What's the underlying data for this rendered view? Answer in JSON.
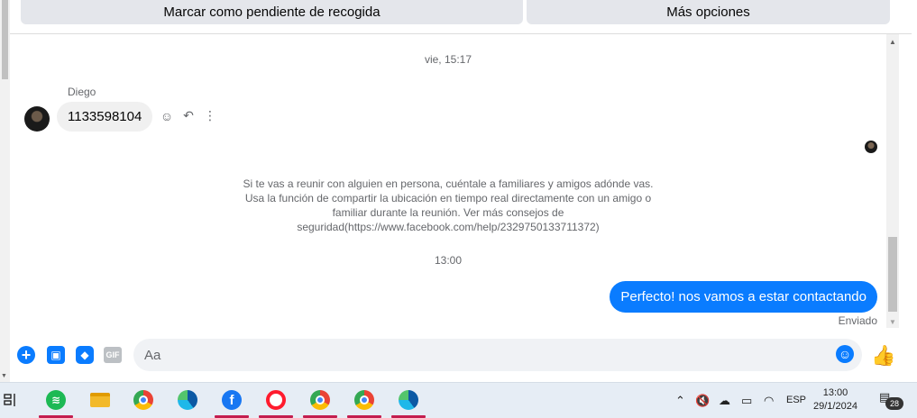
{
  "topbar": {
    "pending_pickup_label": "Marcar como pendiente de recogida",
    "more_options_label": "Más opciones"
  },
  "chat": {
    "timestamp_1": "vie, 15:17",
    "sender_name": "Diego",
    "incoming_message": "1133598104",
    "safety_notice": "Si te vas a reunir con alguien en persona, cuéntale a familiares y amigos adónde vas. Usa la función de compartir la ubicación en tiempo real directamente con un amigo o familiar durante la reunión. Ver más consejos de seguridad(https://www.facebook.com/help/2329750133711372)",
    "timestamp_2": "13:00",
    "outgoing_message": "Perfecto! nos vamos a estar contactando",
    "sent_status": "Enviado"
  },
  "composer": {
    "placeholder": "Aa",
    "gif_label": "GIF"
  },
  "taskbar": {
    "apps": [
      "task-view",
      "spotify",
      "file-explorer",
      "chrome",
      "edge",
      "facebook",
      "opera",
      "chrome-profile-1",
      "chrome-profile-2",
      "edge-profile"
    ],
    "language": "ESP",
    "time": "13:00",
    "date": "29/1/2024",
    "notification_count": "28"
  },
  "colors": {
    "messenger_blue": "#0a7cff",
    "taskbar_active_indicator": "#c41d4e"
  }
}
